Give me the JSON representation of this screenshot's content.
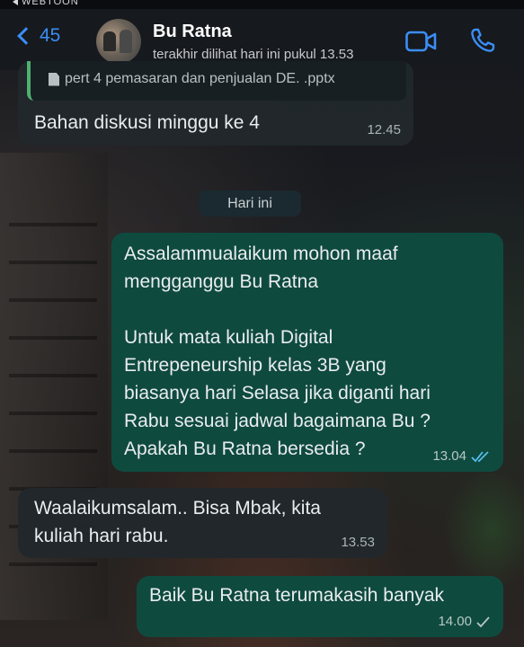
{
  "status": {
    "back_app": "WEBTOON"
  },
  "header": {
    "back_count": "45",
    "contact_name": "Bu Ratna",
    "last_seen": "terakhir dilihat hari ini pukul 13.53",
    "icons": {
      "back": "chevron-left-icon",
      "video": "video-camera-icon",
      "phone": "phone-icon"
    },
    "accent_color": "#3b8df5"
  },
  "messages": [
    {
      "direction": "in",
      "attachment": "pert 4 pemasaran dan penjualan DE. .pptx",
      "text": "Bahan diskusi minggu ke 4",
      "time": "12.45"
    },
    {
      "type": "date",
      "label": "Hari ini"
    },
    {
      "direction": "out",
      "lines": [
        "Assalammualaikum mohon maaf",
        "mengganggu Bu Ratna",
        "",
        "Untuk mata kuliah Digital",
        "Entrepeneurship kelas 3B yang",
        "biasanya hari Selasa jika diganti hari",
        "Rabu sesuai jadwal bagaimana Bu ?",
        "Apakah Bu Ratna bersedia ?"
      ],
      "time": "13.04",
      "ticks": "read"
    },
    {
      "direction": "in",
      "lines": [
        "Waalaikumsalam.. Bisa Mbak, kita",
        "kuliah hari rabu."
      ],
      "time": "13.53"
    },
    {
      "direction": "out",
      "lines": [
        "Baik Bu Ratna terumakasih banyak"
      ],
      "time": "14.00",
      "ticks": "sent"
    }
  ],
  "colors": {
    "outgoing_bubble": "#0f4a3f",
    "incoming_bubble": "#21282c",
    "read_ticks": "#53bdeb"
  }
}
